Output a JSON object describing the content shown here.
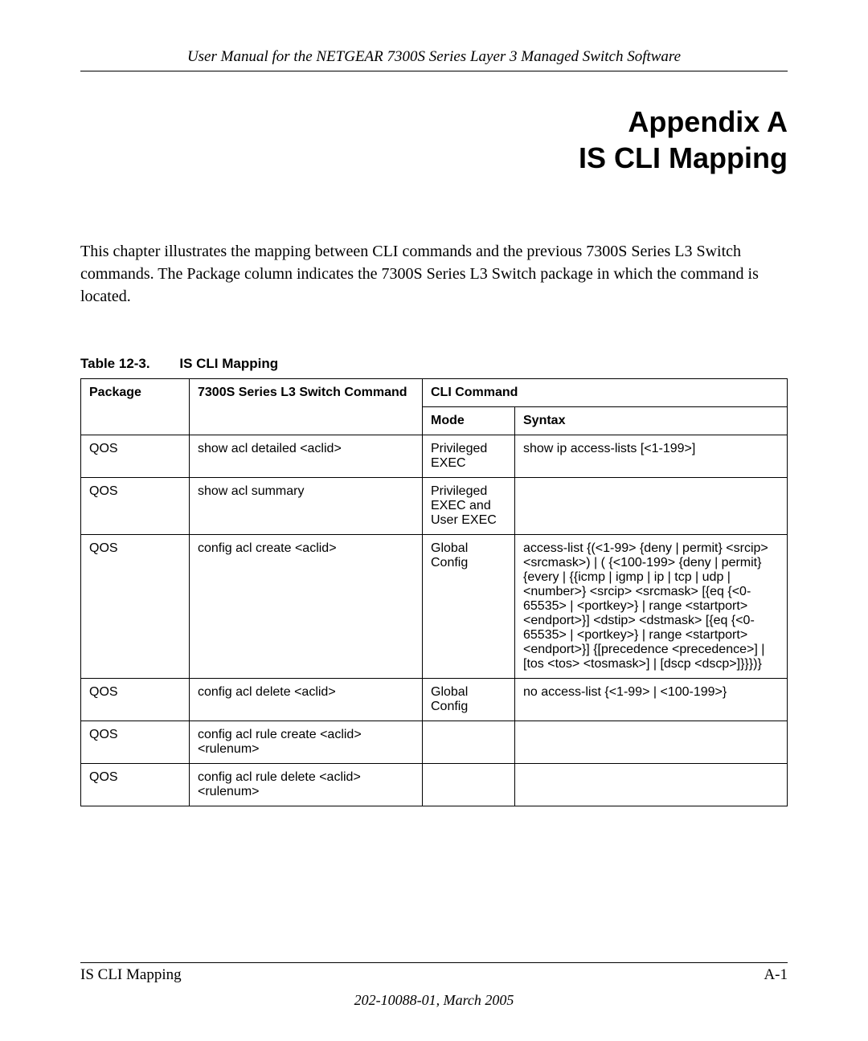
{
  "header": {
    "running_title": "User Manual for the NETGEAR 7300S Series Layer 3 Managed Switch Software"
  },
  "title": {
    "line1": "Appendix A",
    "line2": "IS CLI Mapping"
  },
  "intro": "This chapter illustrates the mapping between CLI commands and the previous 7300S Series L3 Switch commands. The Package column indicates the 7300S Series L3 Switch package in which the command is located.",
  "table": {
    "caption_number": "Table 12-3.",
    "caption_title": "IS CLI Mapping",
    "headers": {
      "package": "Package",
      "command": "7300S Series L3 Switch Command",
      "cli": "CLI Command",
      "mode": "Mode",
      "syntax": "Syntax"
    },
    "rows": [
      {
        "package": "QOS",
        "command": "show acl detailed <aclid>",
        "mode": "Privileged EXEC",
        "syntax": "show ip access-lists [<1-199>]"
      },
      {
        "package": "QOS",
        "command": "show acl summary",
        "mode": "Privileged EXEC and User EXEC",
        "syntax": ""
      },
      {
        "package": "QOS",
        "command": "config acl create <aclid>",
        "mode": "Global Config",
        "syntax": "access-list {(<1-99> {deny | permit} <srcip> <srcmask>) | ( {<100-199> {deny | permit} {every | {{icmp | igmp | ip | tcp | udp | <number>} <srcip> <srcmask> [{eq {<0-65535> | <portkey>} | range <startport> <endport>}] <dstip> <dstmask> [{eq {<0-65535> | <portkey>} | range <startport> <endport>}] {[precedence <precedence>] | [tos <tos> <tosmask>] | [dscp <dscp>]}}})}"
      },
      {
        "package": "QOS",
        "command": "config acl delete <aclid>",
        "mode": "Global Config",
        "syntax": "no access-list {<1-99> | <100-199>}"
      },
      {
        "package": "QOS",
        "command": "config acl rule create <aclid> <rulenum>",
        "mode": "",
        "syntax": ""
      },
      {
        "package": "QOS",
        "command": "config acl rule delete <aclid> <rulenum>",
        "mode": "",
        "syntax": ""
      }
    ]
  },
  "footer": {
    "section": "IS CLI Mapping",
    "page_number": "A-1",
    "publication": "202-10088-01, March 2005"
  }
}
